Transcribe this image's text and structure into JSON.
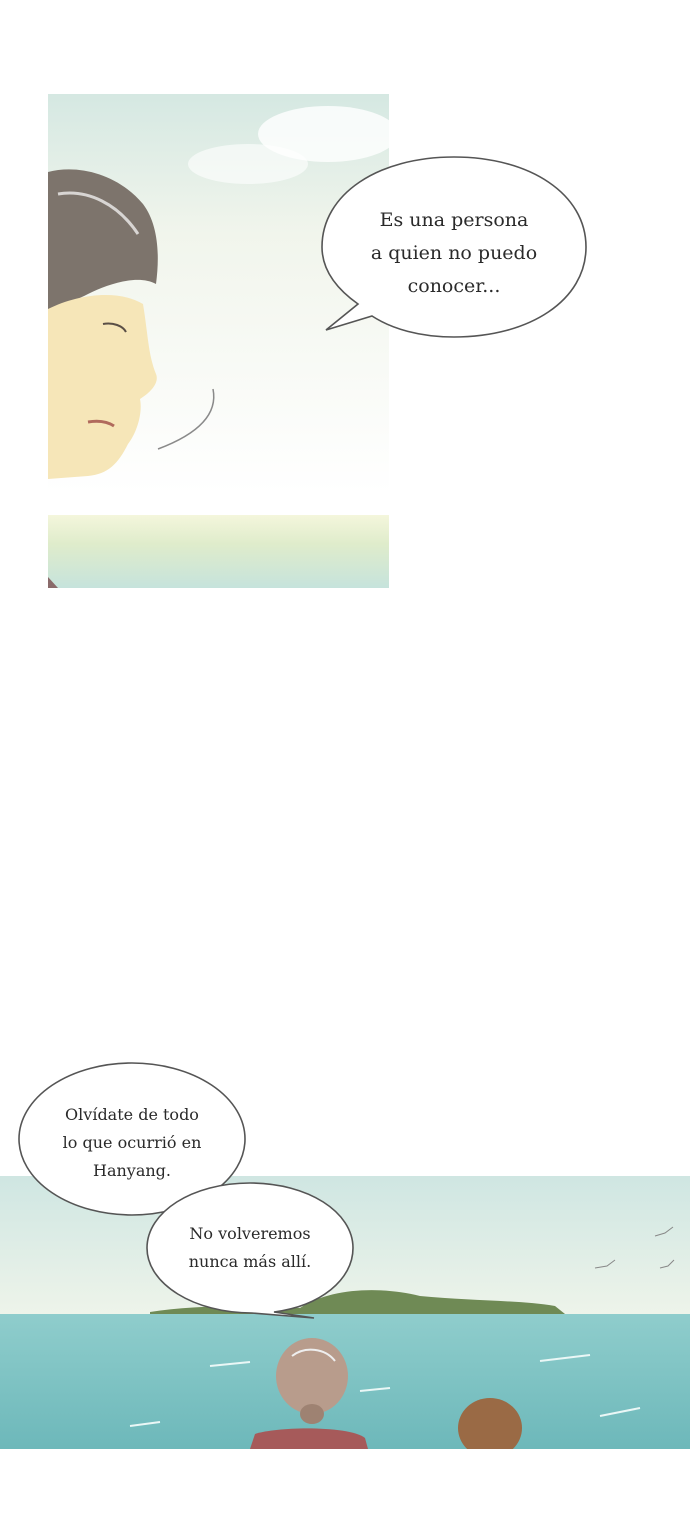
{
  "panels": [
    {
      "id": "panel-1",
      "description_icon": "old-woman-profile-image"
    },
    {
      "id": "panel-2",
      "description_icon": "sky-strip-image"
    },
    {
      "id": "panel-3",
      "description_icon": "sea-shore-image"
    }
  ],
  "bubbles": {
    "b1": {
      "lines": [
        "Es una persona",
        "a quien no puedo",
        "conocer..."
      ]
    },
    "b2": {
      "lines": [
        "Olvídate de todo",
        "lo que ocurrió en",
        "Hanyang."
      ]
    },
    "b3": {
      "lines": [
        "No volveremos",
        "nunca más allí."
      ]
    }
  },
  "colors": {
    "sky": "#dfeee8",
    "sea": "#7cc3c4",
    "island": "#6f8a55",
    "bubble_stroke": "#555555",
    "skin": "#f6e6b8",
    "hair": "#7d746c"
  }
}
